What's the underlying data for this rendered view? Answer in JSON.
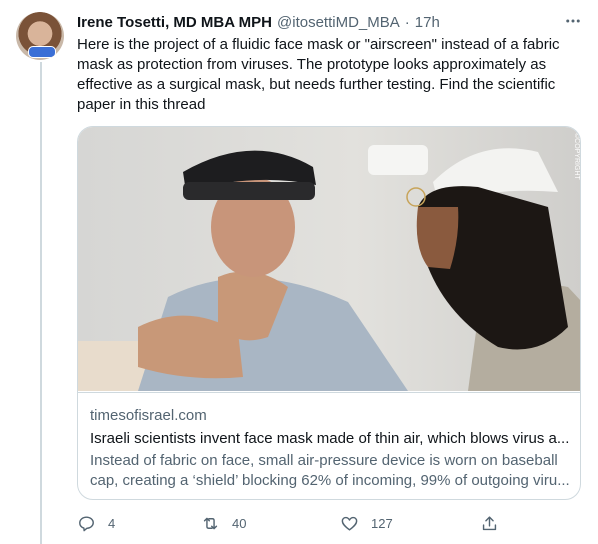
{
  "tweet": {
    "author_name": "Irene Tosetti, MD MBA MPH",
    "author_handle": "@itosettiMD_MBA",
    "time_sep": "·",
    "time": "17h",
    "more_icon": "more-horizontal-icon",
    "text": "Here is the project of a fluidic face mask or \"airscreen\" instead of a fabric mask as protection from viruses. The prototype looks approximately as effective as a surgical mask, but needs further testing. Find the scientific paper in this thread"
  },
  "card": {
    "image_watermark": "©COPYRIGHT",
    "domain": "timesofisrael.com",
    "title": "Israeli scientists invent face mask made of thin air, which blows virus a...",
    "description": "Instead of fabric on face, small air-pressure device is worn on baseball cap, creating a ‘shield’ blocking 62% of incoming, 99% of outgoing viru..."
  },
  "actions": {
    "reply_count": "4",
    "retweet_count": "40",
    "like_count": "127"
  },
  "colors": {
    "text_primary": "#0f1419",
    "text_secondary": "#536471",
    "border": "#cfd9de"
  }
}
